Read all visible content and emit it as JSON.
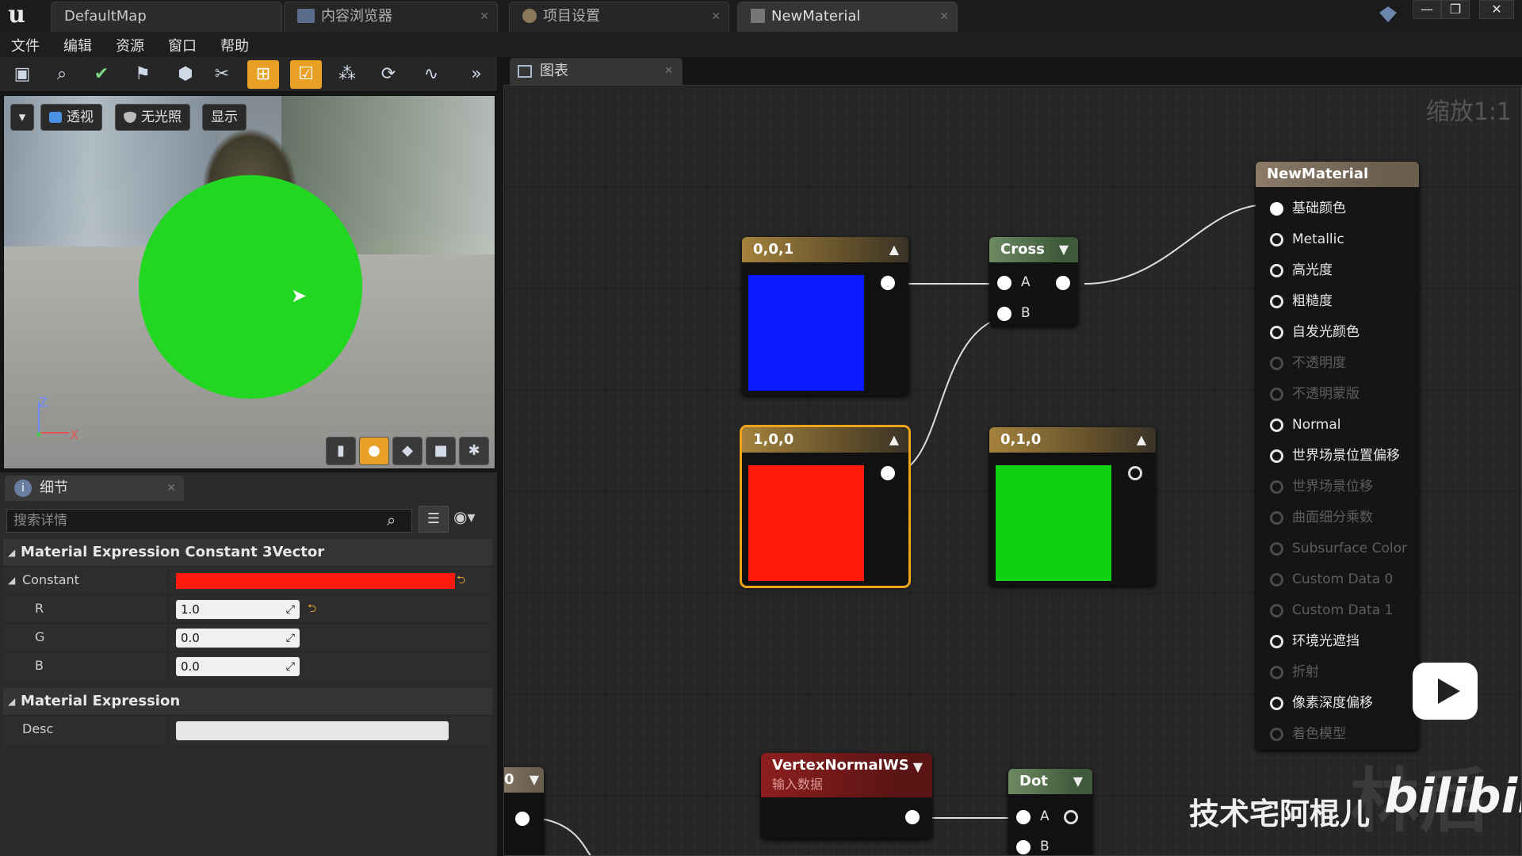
{
  "window": {
    "tabs": [
      {
        "label": "DefaultMap"
      },
      {
        "label": "内容浏览器"
      },
      {
        "label": "项目设置"
      },
      {
        "label": "NewMaterial"
      }
    ],
    "min": "—",
    "max": "❐",
    "close": "✕"
  },
  "menu": [
    "文件",
    "编辑",
    "资源",
    "窗口",
    "帮助"
  ],
  "toolbar": {
    "more": "»"
  },
  "viewport": {
    "perspective": "透视",
    "unlit": "无光照",
    "show": "显示",
    "axis_z": "Z",
    "axis_x": "X",
    "sphere_color": "#22d722"
  },
  "details": {
    "tab_label": "细节",
    "search_placeholder": "搜索详情",
    "section1": "Material Expression Constant 3Vector",
    "constant_label": "Constant",
    "constant_color": "#ff1a0f",
    "r_label": "R",
    "r_value": "1.0",
    "g_label": "G",
    "g_value": "0.0",
    "b_label": "B",
    "b_value": "0.0",
    "section2": "Material Expression",
    "desc_label": "Desc"
  },
  "graph": {
    "tab_label": "图表",
    "zoom": "缩放1:1",
    "nodes": {
      "blue": {
        "title": "0,0,1",
        "color": "#0a1cff"
      },
      "red": {
        "title": "1,0,0",
        "color": "#ff1a0a"
      },
      "green": {
        "title": "0,1,0",
        "color": "#0fd10f"
      },
      "cross": {
        "title": "Cross",
        "pin_a": "A",
        "pin_b": "B"
      },
      "vertex": {
        "title": "VertexNormalWS",
        "subtitle": "输入数据"
      },
      "dot": {
        "title": "Dot",
        "pin_a": "A",
        "pin_b": "B"
      },
      "partial": {
        "title": "0"
      }
    },
    "material": {
      "title": "NewMaterial",
      "inputs": [
        {
          "label": "基础颜色"
        },
        {
          "label": "Metallic"
        },
        {
          "label": "高光度"
        },
        {
          "label": "粗糙度"
        },
        {
          "label": "自发光颜色"
        },
        {
          "label": "不透明度"
        },
        {
          "label": "不透明蒙版"
        },
        {
          "label": "Normal"
        },
        {
          "label": "世界场景位置偏移"
        },
        {
          "label": "世界场景位移"
        },
        {
          "label": "曲面细分乘数"
        },
        {
          "label": "Subsurface Color"
        },
        {
          "label": "Custom Data 0"
        },
        {
          "label": "Custom Data 1"
        },
        {
          "label": "环境光遮挡"
        },
        {
          "label": "折射"
        },
        {
          "label": "像素深度偏移"
        },
        {
          "label": "着色模型"
        }
      ]
    }
  },
  "watermark": {
    "author": "技术宅阿棍儿",
    "bg_text": "林后",
    "logo": "bilibili"
  }
}
